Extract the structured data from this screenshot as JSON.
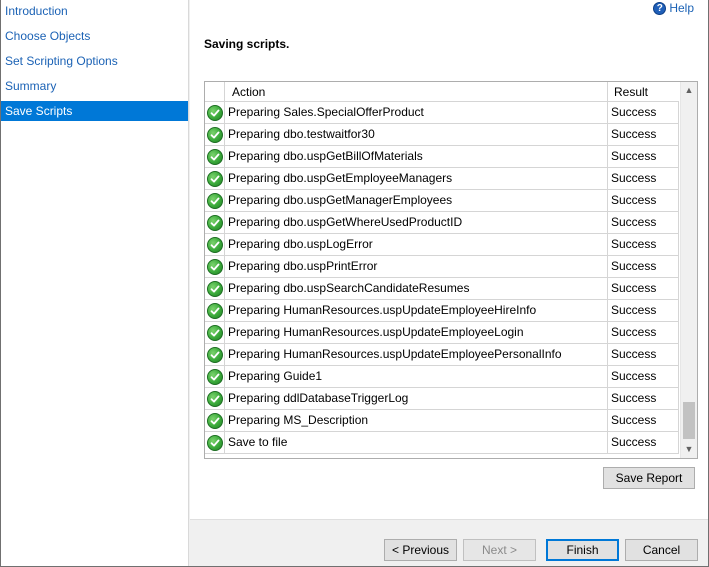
{
  "sidebar": {
    "items": [
      {
        "label": "Introduction",
        "active": false
      },
      {
        "label": "Choose Objects",
        "active": false
      },
      {
        "label": "Set Scripting Options",
        "active": false
      },
      {
        "label": "Summary",
        "active": false
      },
      {
        "label": "Save Scripts",
        "active": true
      }
    ]
  },
  "header": {
    "help_label": "Help",
    "help_icon": "help-icon",
    "title": "Saving scripts."
  },
  "grid": {
    "columns": [
      "Action",
      "Result"
    ],
    "status_icon": "success-check-icon",
    "rows": [
      {
        "action": "Preparing Sales.SpecialOfferProduct",
        "result": "Success"
      },
      {
        "action": "Preparing dbo.testwaitfor30",
        "result": "Success"
      },
      {
        "action": "Preparing dbo.uspGetBillOfMaterials",
        "result": "Success"
      },
      {
        "action": "Preparing dbo.uspGetEmployeeManagers",
        "result": "Success"
      },
      {
        "action": "Preparing dbo.uspGetManagerEmployees",
        "result": "Success"
      },
      {
        "action": "Preparing dbo.uspGetWhereUsedProductID",
        "result": "Success"
      },
      {
        "action": "Preparing dbo.uspLogError",
        "result": "Success"
      },
      {
        "action": "Preparing dbo.uspPrintError",
        "result": "Success"
      },
      {
        "action": "Preparing dbo.uspSearchCandidateResumes",
        "result": "Success"
      },
      {
        "action": "Preparing HumanResources.uspUpdateEmployeeHireInfo",
        "result": "Success"
      },
      {
        "action": "Preparing HumanResources.uspUpdateEmployeeLogin",
        "result": "Success"
      },
      {
        "action": "Preparing HumanResources.uspUpdateEmployeePersonalInfo",
        "result": "Success"
      },
      {
        "action": "Preparing Guide1",
        "result": "Success"
      },
      {
        "action": "Preparing ddlDatabaseTriggerLog",
        "result": "Success"
      },
      {
        "action": "Preparing MS_Description",
        "result": "Success"
      },
      {
        "action": "Save to file",
        "result": "Success"
      }
    ],
    "scroll_position": 1.0
  },
  "buttons": {
    "save_report": "Save Report",
    "previous": "< Previous",
    "next": "Next >",
    "finish": "Finish",
    "cancel": "Cancel"
  },
  "colors": {
    "accent": "#0078d7",
    "link": "#1b62b5",
    "success": "#3aa93a"
  }
}
